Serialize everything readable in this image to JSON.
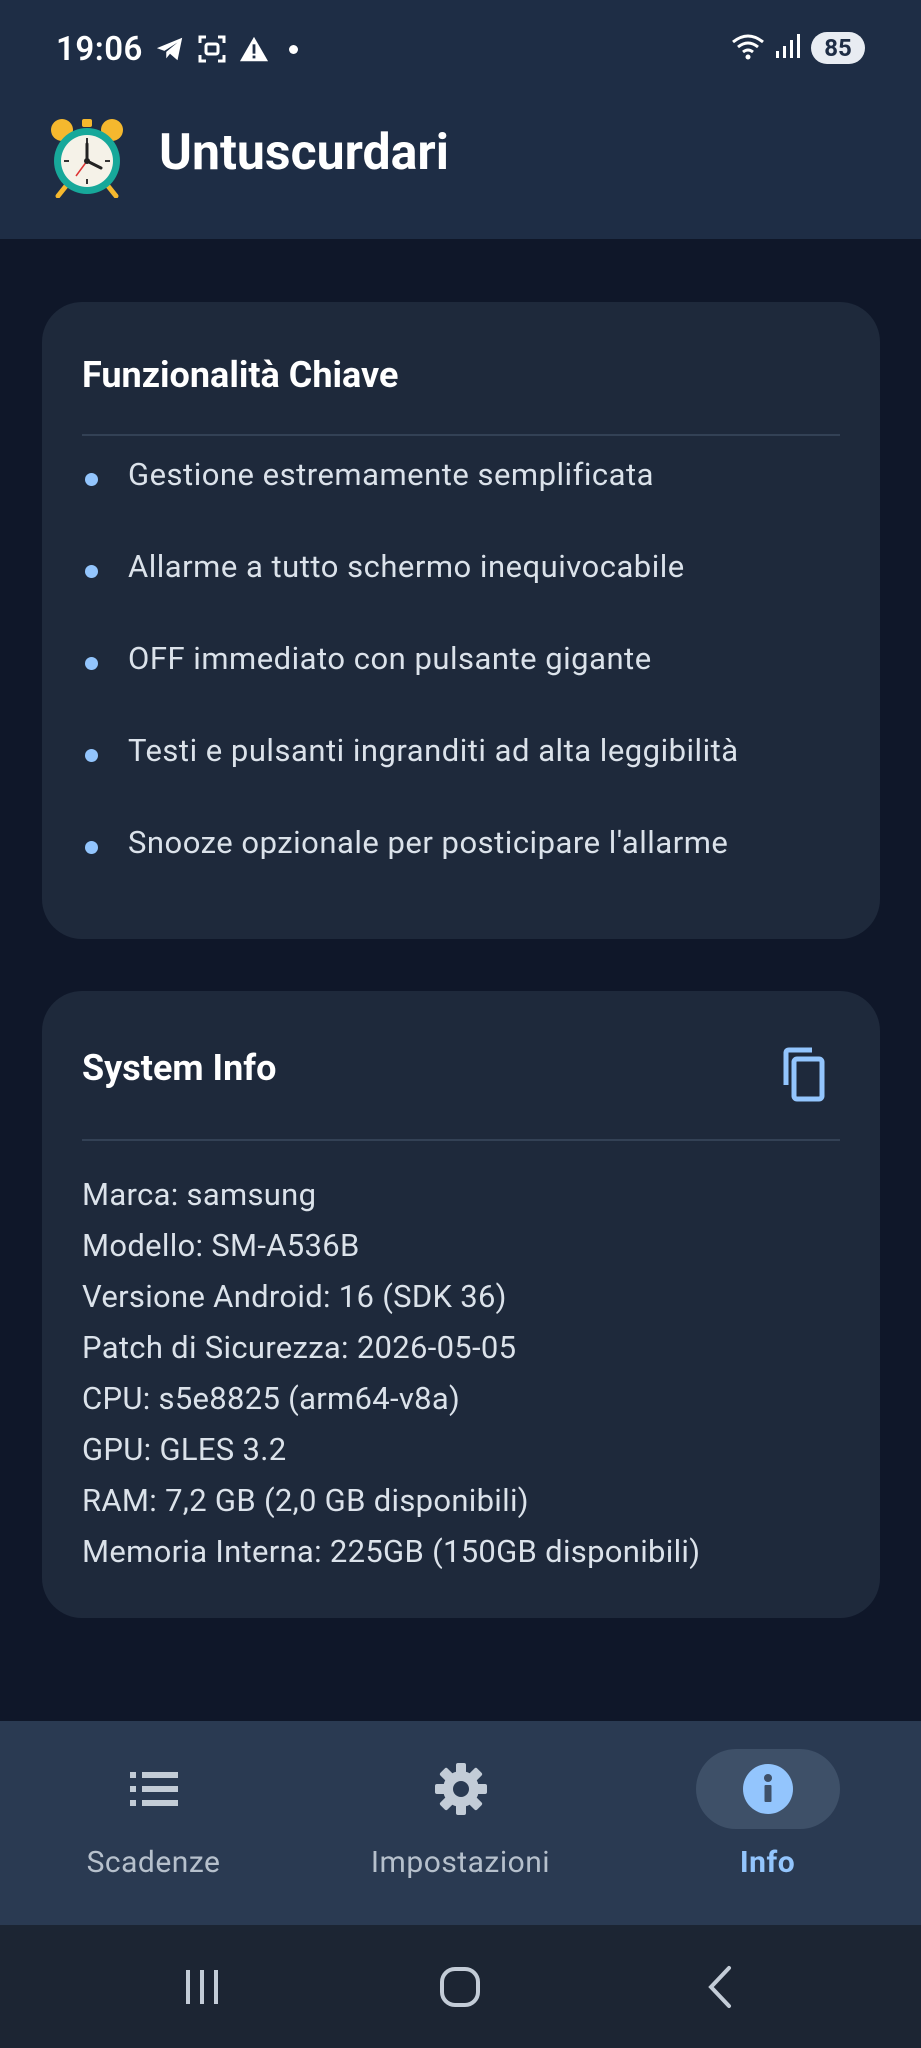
{
  "status_bar": {
    "time": "19:06",
    "battery": "85",
    "left_icons": [
      "telegram-icon",
      "screenshot-icon",
      "warning-icon",
      "notification-dot"
    ],
    "right_icons": [
      "wifi-icon",
      "signal-icon",
      "battery-icon"
    ]
  },
  "app_bar": {
    "title": "Untuscurdari",
    "logo": "alarm-clock-icon"
  },
  "features_card": {
    "title": "Funzionalità Chiave",
    "items": [
      "Gestione estremamente semplificata",
      "Allarme a tutto schermo inequivocabile",
      "OFF immediato con pulsante gigante",
      "Testi e pulsanti ingranditi ad alta leggibilità",
      "Snooze opzionale per posticipare l'allarme"
    ]
  },
  "system_info_card": {
    "title": "System Info",
    "copy_icon": "copy-icon",
    "lines": [
      "Marca: samsung",
      "Modello: SM-A536B",
      "Versione Android: 16 (SDK 36)",
      "Patch di Sicurezza: 2026-05-05",
      "CPU: s5e8825 (arm64-v8a)",
      "GPU: GLES 3.2",
      "RAM: 7,2 GB (2,0 GB disponibili)",
      "Memoria Interna: 225GB (150GB disponibili)"
    ]
  },
  "bottom_nav": {
    "items": [
      {
        "label": "Scadenze",
        "icon": "list-icon",
        "active": false
      },
      {
        "label": "Impostazioni",
        "icon": "gear-icon",
        "active": false
      },
      {
        "label": "Info",
        "icon": "info-icon",
        "active": true
      }
    ]
  },
  "system_nav": {
    "buttons": [
      "recents-icon",
      "home-icon",
      "back-icon"
    ]
  },
  "colors": {
    "background": "#0f1729",
    "app_bar": "#1e2d45",
    "card": "#1e293b",
    "accent": "#93c5fd",
    "bottom_nav": "#2a3a52"
  }
}
